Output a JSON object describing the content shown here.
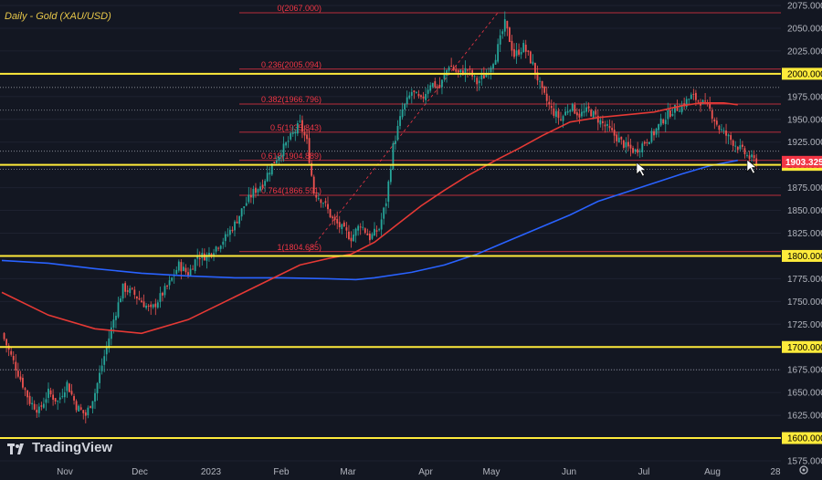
{
  "header": {
    "title": "Daily - Gold (XAU/USD)"
  },
  "brand": {
    "name": "TradingView"
  },
  "colors": {
    "background": "#131722",
    "up": "#26a69a",
    "down": "#ef5350",
    "ma_red": "#e53935",
    "ma_blue": "#2962ff",
    "support": "#ffeb3b",
    "fib": "#f23645",
    "price_tag": "#f23645"
  },
  "chart_data": {
    "type": "candlestick",
    "instrument": "XAU/USD",
    "timeframe": "Daily",
    "ylim": [
      1575,
      2075
    ],
    "y_ticks": [
      1575,
      1600,
      1625,
      1650,
      1675,
      1700,
      1725,
      1750,
      1775,
      1800,
      1825,
      1850,
      1875,
      1900,
      1925,
      1950,
      1975,
      2000,
      2025,
      2050,
      2075
    ],
    "x_labels": [
      "Nov",
      "Dec",
      "2023",
      "Feb",
      "Mar",
      "Apr",
      "May",
      "Jun",
      "Jul",
      "Aug",
      "28"
    ],
    "last_price": "1903.325",
    "support_levels": [
      1600,
      1700,
      1800,
      1900,
      2000
    ],
    "support_labels": [
      "1600.000",
      "1700.000",
      "1800.000",
      "1900.000",
      "2000.000"
    ],
    "fib_levels": [
      {
        "label": "0(2067.000)",
        "value": 2067.0
      },
      {
        "label": "0.236(2005.094)",
        "value": 2005.094
      },
      {
        "label": "0.382(1966.796)",
        "value": 1966.796
      },
      {
        "label": "0.5(1935.843)",
        "value": 1935.843
      },
      {
        "label": "0.618(1904.889)",
        "value": 1904.889
      },
      {
        "label": "0.764(1866.591)",
        "value": 1866.591
      },
      {
        "label": "1(1804.685)",
        "value": 1804.685
      }
    ],
    "dotted_levels": [
      1985,
      1960,
      1915,
      1895,
      1675
    ],
    "close_path": [
      [
        0,
        1715
      ],
      [
        4,
        1690
      ],
      [
        8,
        1665
      ],
      [
        12,
        1640
      ],
      [
        16,
        1630
      ],
      [
        20,
        1650
      ],
      [
        24,
        1640
      ],
      [
        28,
        1660
      ],
      [
        32,
        1635
      ],
      [
        36,
        1625
      ],
      [
        40,
        1650
      ],
      [
        44,
        1690
      ],
      [
        48,
        1730
      ],
      [
        52,
        1765
      ],
      [
        56,
        1760
      ],
      [
        60,
        1750
      ],
      [
        64,
        1740
      ],
      [
        68,
        1755
      ],
      [
        72,
        1770
      ],
      [
        76,
        1790
      ],
      [
        80,
        1780
      ],
      [
        84,
        1800
      ],
      [
        88,
        1800
      ],
      [
        92,
        1810
      ],
      [
        96,
        1820
      ],
      [
        100,
        1835
      ],
      [
        104,
        1855
      ],
      [
        108,
        1870
      ],
      [
        112,
        1880
      ],
      [
        116,
        1900
      ],
      [
        120,
        1915
      ],
      [
        124,
        1930
      ],
      [
        128,
        1945
      ],
      [
        131,
        1925
      ],
      [
        134,
        1870
      ],
      [
        138,
        1860
      ],
      [
        142,
        1840
      ],
      [
        146,
        1830
      ],
      [
        150,
        1820
      ],
      [
        154,
        1835
      ],
      [
        158,
        1820
      ],
      [
        162,
        1830
      ],
      [
        165,
        1860
      ],
      [
        168,
        1920
      ],
      [
        172,
        1960
      ],
      [
        176,
        1980
      ],
      [
        180,
        1970
      ],
      [
        184,
        1990
      ],
      [
        188,
        1985
      ],
      [
        192,
        2010
      ],
      [
        196,
        2000
      ],
      [
        200,
        2005
      ],
      [
        204,
        1990
      ],
      [
        208,
        2000
      ],
      [
        212,
        2020
      ],
      [
        216,
        2055
      ],
      [
        220,
        2020
      ],
      [
        224,
        2030
      ],
      [
        228,
        2010
      ],
      [
        232,
        1980
      ],
      [
        236,
        1960
      ],
      [
        240,
        1950
      ],
      [
        244,
        1965
      ],
      [
        248,
        1955
      ],
      [
        252,
        1960
      ],
      [
        256,
        1950
      ],
      [
        260,
        1940
      ],
      [
        264,
        1930
      ],
      [
        268,
        1920
      ],
      [
        272,
        1915
      ],
      [
        276,
        1925
      ],
      [
        280,
        1935
      ],
      [
        284,
        1950
      ],
      [
        288,
        1960
      ],
      [
        292,
        1965
      ],
      [
        296,
        1975
      ],
      [
        300,
        1970
      ],
      [
        304,
        1960
      ],
      [
        308,
        1940
      ],
      [
        312,
        1930
      ],
      [
        316,
        1920
      ],
      [
        320,
        1910
      ],
      [
        324,
        1903
      ]
    ],
    "ma_red": [
      [
        0,
        1760
      ],
      [
        20,
        1735
      ],
      [
        40,
        1720
      ],
      [
        60,
        1715
      ],
      [
        80,
        1730
      ],
      [
        100,
        1755
      ],
      [
        116,
        1775
      ],
      [
        128,
        1790
      ],
      [
        140,
        1797
      ],
      [
        150,
        1802
      ],
      [
        160,
        1815
      ],
      [
        170,
        1835
      ],
      [
        180,
        1855
      ],
      [
        190,
        1872
      ],
      [
        200,
        1888
      ],
      [
        212,
        1905
      ],
      [
        222,
        1918
      ],
      [
        232,
        1932
      ],
      [
        244,
        1947
      ],
      [
        256,
        1952
      ],
      [
        268,
        1955
      ],
      [
        280,
        1958
      ],
      [
        292,
        1965
      ],
      [
        300,
        1968
      ],
      [
        310,
        1968
      ],
      [
        316,
        1966
      ]
    ],
    "ma_blue": [
      [
        0,
        1795
      ],
      [
        20,
        1792
      ],
      [
        40,
        1786
      ],
      [
        60,
        1781
      ],
      [
        80,
        1778
      ],
      [
        100,
        1776
      ],
      [
        120,
        1776
      ],
      [
        140,
        1775
      ],
      [
        152,
        1774
      ],
      [
        160,
        1776
      ],
      [
        176,
        1782
      ],
      [
        190,
        1790
      ],
      [
        204,
        1802
      ],
      [
        216,
        1815
      ],
      [
        230,
        1830
      ],
      [
        244,
        1845
      ],
      [
        256,
        1860
      ],
      [
        268,
        1870
      ],
      [
        280,
        1880
      ],
      [
        292,
        1890
      ],
      [
        304,
        1899
      ],
      [
        316,
        1905
      ]
    ]
  }
}
